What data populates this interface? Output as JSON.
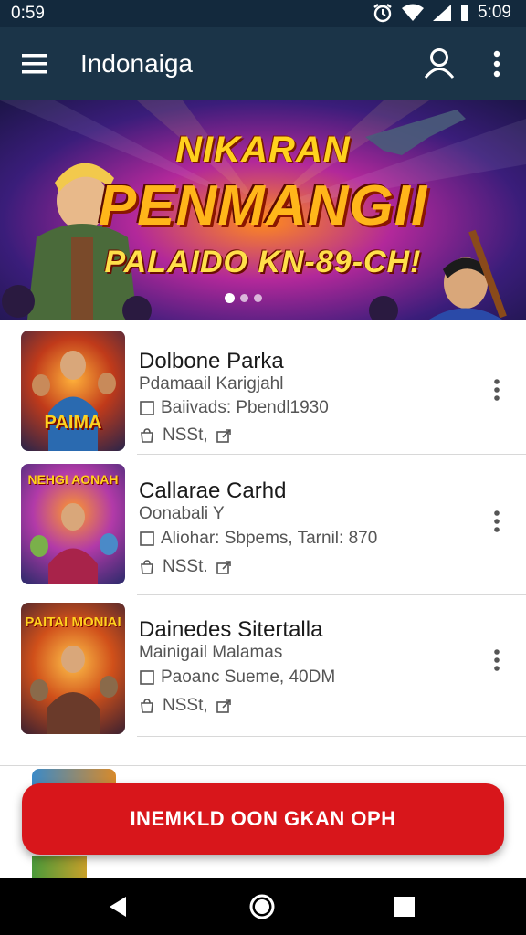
{
  "status_bar": {
    "time_left": "0:59",
    "time_right": "5:09"
  },
  "app_bar": {
    "title": "Indonaiga",
    "icons": {
      "menu": "hamburger-menu-icon",
      "account": "account-icon",
      "overflow": "overflow-menu-icon"
    }
  },
  "banner": {
    "line1": "NIKARAN",
    "line2": "PENMANGII",
    "line3": "PALAIDO KN-89-CH!",
    "dots": [
      true,
      false,
      false
    ],
    "colors": {
      "title": "#ffb61a",
      "glow": "#b2289a"
    }
  },
  "list": {
    "items": [
      {
        "title": "Dolbone Parka",
        "subtitle": "Pdamaail Karigjahl",
        "meta": "Baiivads: Pbendl1930",
        "tag": "NSSt,",
        "thumb_text": "PAIMA"
      },
      {
        "title": "Callarae Carhd",
        "subtitle": "Oonabali Y",
        "meta": "Aliohar: Sbpems, Tarnil: 870",
        "tag": "NSSt.",
        "thumb_text": "NEHGI AONAH"
      },
      {
        "title": "Dainedes Sitertalla",
        "subtitle": "Mainigail Malamas",
        "meta": "Paoanc Sueme, 40DM",
        "tag": "NSSt,",
        "thumb_text": "PAITAI MONIAI"
      }
    ]
  },
  "cta": {
    "label": "INEMKLD OON GKAN OPH",
    "color": "#d8161b"
  },
  "nav_bar": {
    "icons": {
      "back": "back-triangle-icon",
      "home": "home-circle-icon",
      "recents": "recents-square-icon"
    }
  }
}
